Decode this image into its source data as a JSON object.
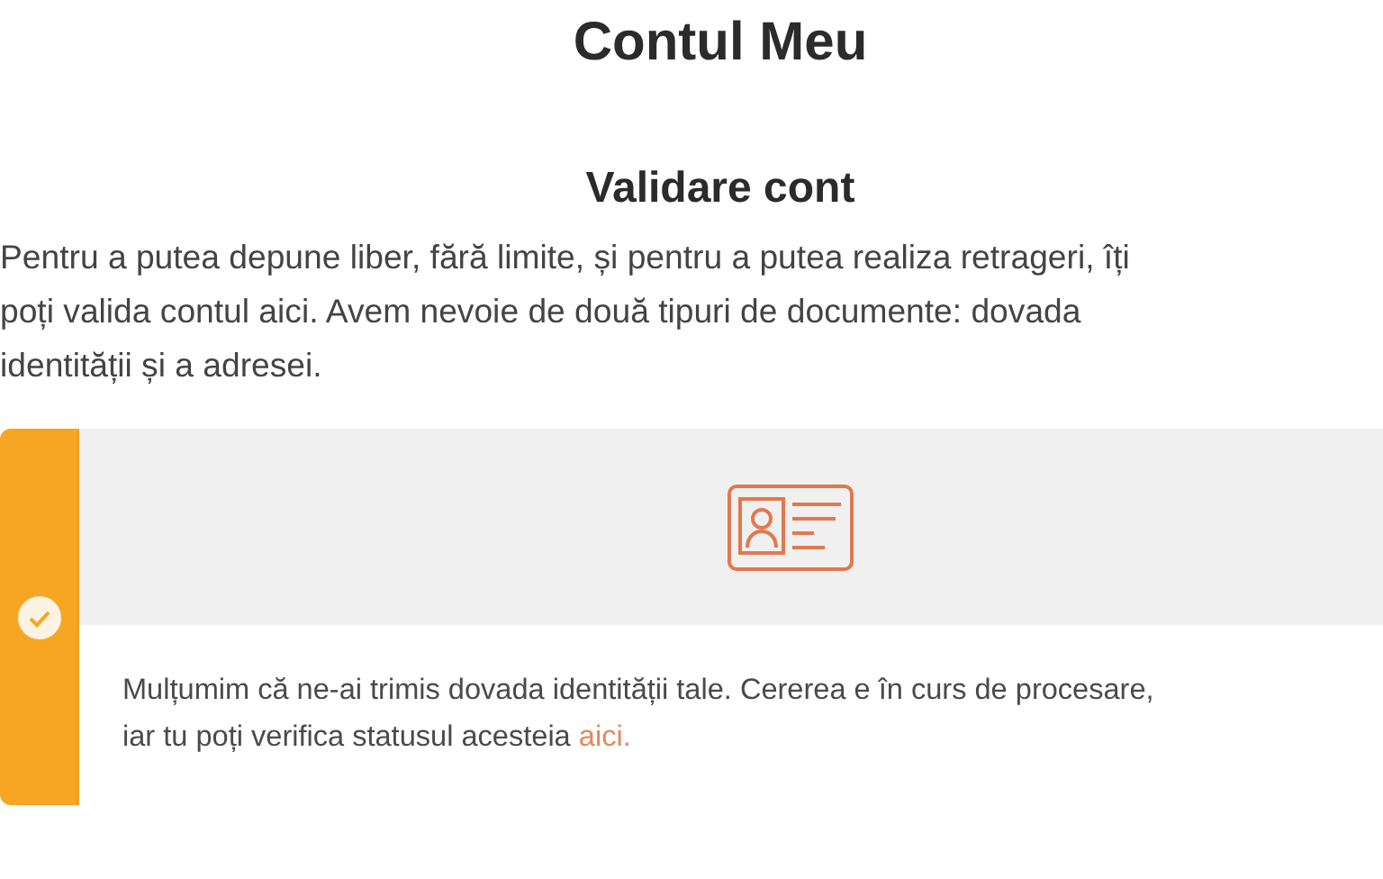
{
  "page_title": "Contul Meu",
  "section_title": "Validare cont",
  "intro": {
    "lines": [
      "Pentru a putea depune liber, fără limite, și pentru a putea realiza retrageri, îți",
      "poți valida contul aici. Avem nevoie de două tipuri de documente: dovada",
      "identității și a adresei."
    ]
  },
  "document_card": {
    "completed": true,
    "message": {
      "lines": [
        "Mulțumim că ne-ai trimis dovada identității tale. Cererea e în curs de procesare,",
        "iar tu poți verifica statusul acesteia"
      ],
      "link": "aici."
    }
  }
}
